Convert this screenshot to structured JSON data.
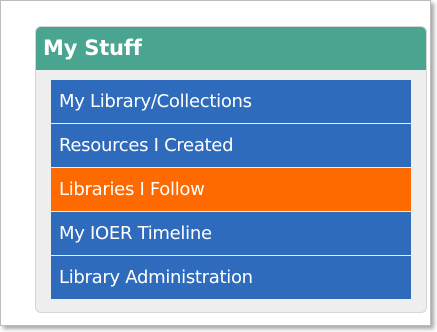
{
  "panel": {
    "title": "My Stuff",
    "header_color": "#4aa590"
  },
  "menu": {
    "items": [
      {
        "label": "My Library/Collections",
        "active": false
      },
      {
        "label": "Resources I Created",
        "active": false
      },
      {
        "label": "Libraries I Follow",
        "active": true
      },
      {
        "label": "My IOER Timeline",
        "active": false
      },
      {
        "label": "Library Administration",
        "active": false
      }
    ],
    "item_color": "#2f6bbc",
    "active_color": "#ff6a00"
  }
}
